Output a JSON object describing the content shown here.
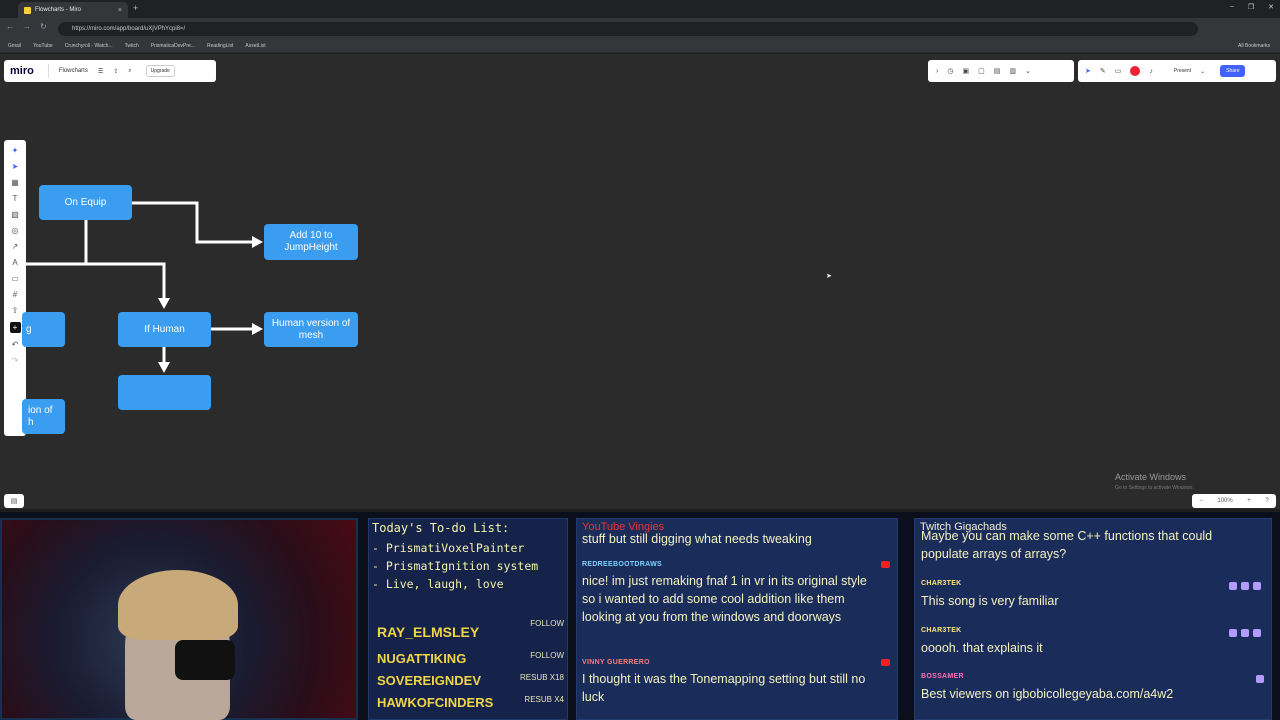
{
  "browser": {
    "tab_title": "Flowcharts - Miro",
    "new_tab": "+",
    "url": "https://miro.com/app/board/uXjVPhYcpi8=/",
    "bookmarks": [
      "Gmail",
      "YouTube",
      "Crunchyroll - Watch...",
      "Twitch",
      "PrismaticaDevPre...",
      "ReadingList",
      "AssetList"
    ],
    "all_bookmarks": "All Bookmarks"
  },
  "miro": {
    "logo": "miro",
    "board_name": "Flowcharts",
    "upgrade": "Upgrade",
    "present": "Present",
    "share": "Share",
    "nodes": {
      "on_equip": "On Equip",
      "add_jump": "Add 10 to\nJumpHeight",
      "if_human": "If Human",
      "human_mesh": "Human version of\nmesh",
      "partial_left1": "g",
      "partial_left2": "ion of\nh",
      "empty": ""
    },
    "zoom": "100%",
    "watermark_title": "Activate Windows",
    "watermark_sub": "Go to Settings to activate Windows."
  },
  "overlay": {
    "todo_title": "Today's To-do List:",
    "todo_items": [
      "- PrismatiVoxelPainter",
      "- PrismatIgnition system",
      "- Live, laugh, love"
    ],
    "recent": [
      {
        "name": "RAY_ELMSLEY",
        "tag": "FOLLOW"
      },
      {
        "name": "NUGATTIKING",
        "tag": "FOLLOW"
      },
      {
        "name": "SOVEREIGNDEV",
        "tag": "RESUB X18"
      },
      {
        "name": "HAWKOFCINDERS",
        "tag": "RESUB X4"
      }
    ],
    "yt_header": "YouTube Vingies",
    "yt_messages": [
      {
        "user": "",
        "text": "stuff but still digging what needs tweaking"
      },
      {
        "user": "REDREEBOOTDRAWS",
        "text": "nice! im just remaking fnaf 1 in vr in its original style so i wanted to add some cool addition like them looking at you from the windows and doorways"
      },
      {
        "user": "VINNY GUERRERO",
        "text": "I thought it was the Tonemapping setting but still no luck"
      }
    ],
    "tw_header": "Twitch Gigachads",
    "tw_messages": [
      {
        "user": "",
        "text": "Maybe you can make some C++ functions that could populate arrays of arrays?"
      },
      {
        "user": "CHAR3TEK",
        "text": "This song is very familiar"
      },
      {
        "user": "CHAR3TEK",
        "text": "ooooh. that explains it"
      },
      {
        "user": "BOSSAMER",
        "text": "Best viewers on igbobicollegeyaba.com/a4w2"
      }
    ]
  },
  "colors": {
    "node": "#3a9df0",
    "canvas": "#2b2b2b",
    "accent": "#4262ff"
  }
}
